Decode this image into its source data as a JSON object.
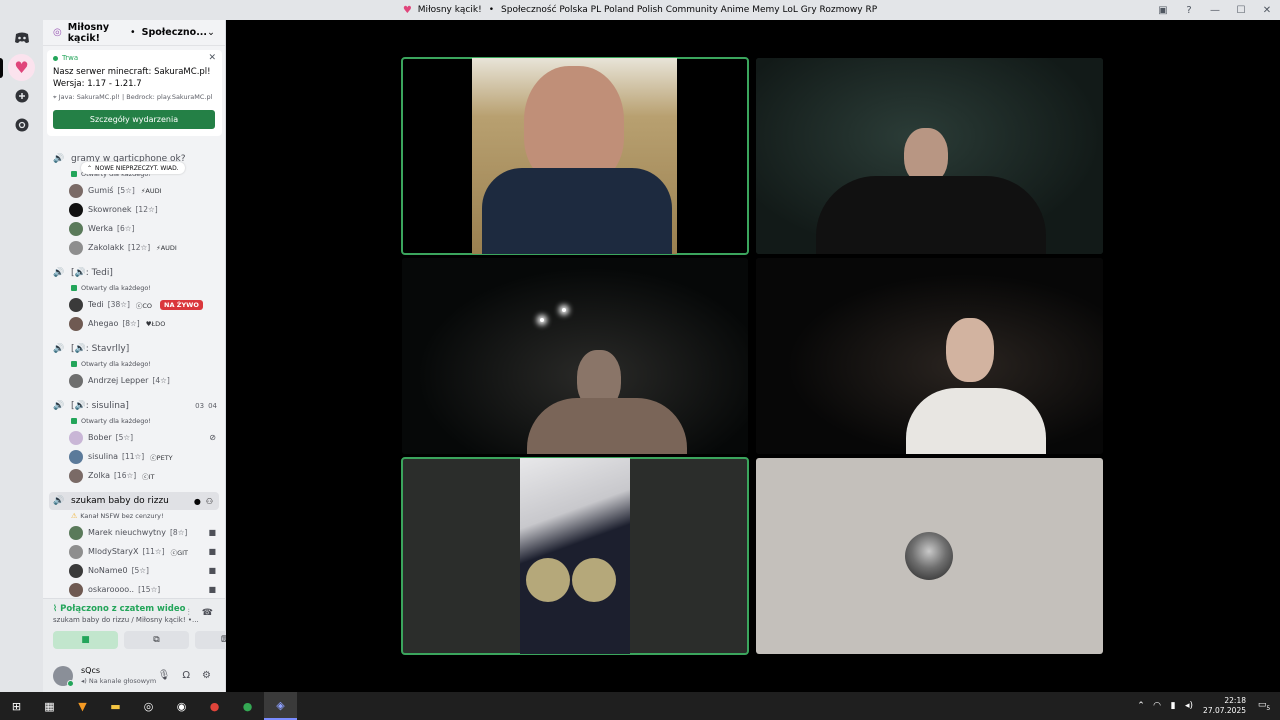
{
  "window": {
    "title_server": "Miłosny kącik!",
    "title_separator": "•",
    "title_community": "Społeczność Polska PL Poland Polish Community Anime Memy LoL Gry Rozmowy RP"
  },
  "server_header": {
    "name": "Miłosny kącik!",
    "separator": "•",
    "community": "Społeczno..."
  },
  "event": {
    "live_label": "Trwa",
    "title": "Nasz serwer minecraft: SakuraMC.pl! Wersja: 1.17 - 1.21.7",
    "location": "Java: SakuraMC.pl! | Bedrock: play.SakuraMC.pl",
    "details_button": "Szczegóły wydarzenia"
  },
  "new_unread": "NOWE NIEPRZECZYT. WIAD.",
  "channels": [
    {
      "name": "gramy w garticphone ok?",
      "status": "Otwarty dla każdego!",
      "users": [
        {
          "name": "Gumiś",
          "level": "[5☆]",
          "badge": "⚡AUDI"
        },
        {
          "name": "Skowronek",
          "level": "[12☆]",
          "badge": ""
        },
        {
          "name": "Werka",
          "level": "[6☆]",
          "badge": ""
        },
        {
          "name": "Zakolakk",
          "level": "[12☆]",
          "badge": "⚡AUDI"
        }
      ]
    },
    {
      "name": "[🔊: Tedi]",
      "status": "Otwarty dla każdego!",
      "users": [
        {
          "name": "Tedi",
          "level": "[38☆]",
          "badge": "ⓒCO",
          "live": "NA ŻYWO"
        },
        {
          "name": "Ahegao",
          "level": "[8☆]",
          "badge": "♥ŁDO"
        }
      ]
    },
    {
      "name": "[🔊: Stavrlly]",
      "status": "Otwarty dla każdego!",
      "users": [
        {
          "name": "Andrzej Lepper",
          "level": "[4☆]",
          "badge": ""
        }
      ]
    },
    {
      "name": "[🔊: sisulina]",
      "status": "Otwarty dla każdego!",
      "counts": [
        "03",
        "04"
      ],
      "users": [
        {
          "name": "Bober",
          "level": "[5☆]",
          "badge": ""
        },
        {
          "name": "sisulina",
          "level": "[11☆]",
          "badge": "ⓒPETY"
        },
        {
          "name": "Zolka",
          "level": "[16☆]",
          "badge": "ⓒIT"
        }
      ]
    },
    {
      "name": "szukam baby do rizzu",
      "status": "Kanał NSFW bez cenzury!",
      "users": [
        {
          "name": "Marek nieuchwytny",
          "level": "[8☆]",
          "badge": ""
        },
        {
          "name": "MlodyStaryX",
          "level": "[11☆]",
          "badge": "ⓒGIT"
        },
        {
          "name": "NoName0",
          "level": "[5☆]",
          "badge": ""
        },
        {
          "name": "oskaroooo..",
          "level": "[15☆]",
          "badge": ""
        }
      ]
    }
  ],
  "voice": {
    "connected": "Połączono z czatem wideo",
    "location": "szukam baby do rizzu / Miłosny kącik! •..."
  },
  "user": {
    "name": "sQcs",
    "status": "Na kanale głosowym"
  },
  "clock": {
    "time": "22:18",
    "date": "27.07.2025"
  },
  "notifications": "5"
}
